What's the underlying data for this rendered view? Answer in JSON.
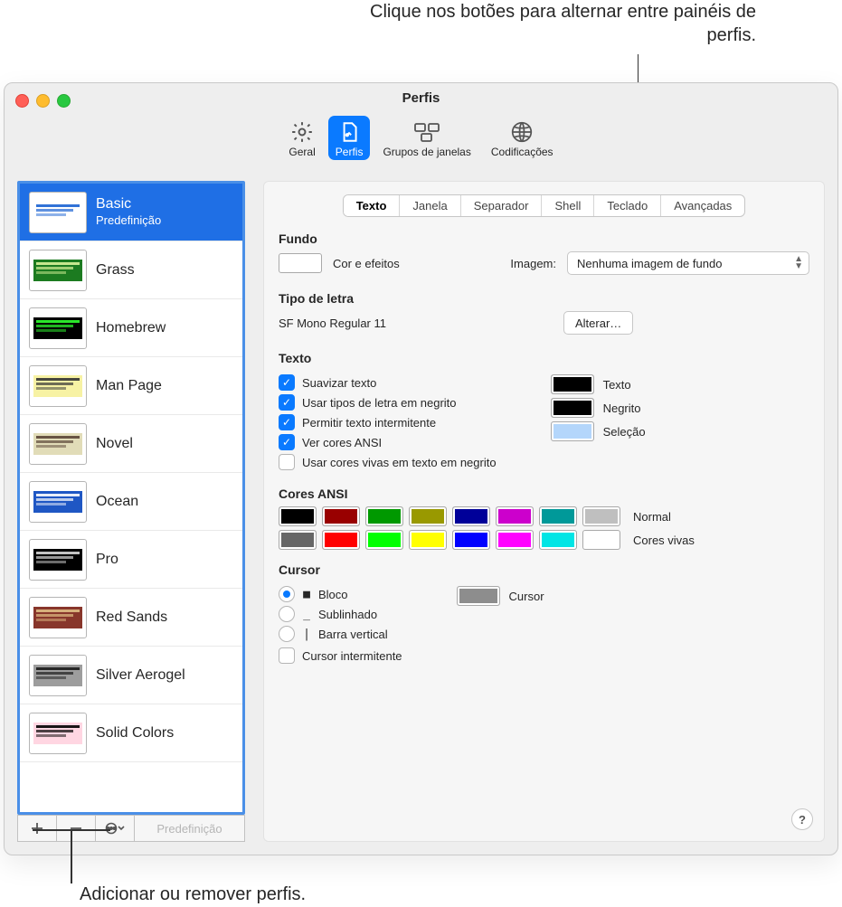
{
  "callouts": {
    "top": "Clique nos botões para alternar entre painéis de perfis.",
    "bottom": "Adicionar ou remover perfis."
  },
  "window": {
    "title": "Perfis"
  },
  "toolbar": {
    "items": [
      {
        "id": "general",
        "label": "Geral"
      },
      {
        "id": "profiles",
        "label": "Perfis"
      },
      {
        "id": "groups",
        "label": "Grupos de janelas"
      },
      {
        "id": "encodings",
        "label": "Codificações"
      }
    ]
  },
  "sidebar": {
    "selected": 0,
    "profiles": [
      {
        "name": "Basic",
        "sub": "Predefinição",
        "bg": "#ffffff",
        "fg": "#1b63d3"
      },
      {
        "name": "Grass",
        "bg": "#1c7b20",
        "fg": "#d9f39a"
      },
      {
        "name": "Homebrew",
        "bg": "#000000",
        "fg": "#2fff2f"
      },
      {
        "name": "Man Page",
        "bg": "#f7f2a4",
        "fg": "#333"
      },
      {
        "name": "Novel",
        "bg": "#e1dcb8",
        "fg": "#5a4436"
      },
      {
        "name": "Ocean",
        "bg": "#1f57c4",
        "fg": "#ffffff"
      },
      {
        "name": "Pro",
        "bg": "#000000",
        "fg": "#d7d7d7"
      },
      {
        "name": "Red Sands",
        "bg": "#88362b",
        "fg": "#dfbc84"
      },
      {
        "name": "Silver Aerogel",
        "bg": "#9d9d9d",
        "fg": "#1b1b1b"
      },
      {
        "name": "Solid Colors",
        "bg": "#ffd6e2",
        "fg": "#000"
      }
    ],
    "footer": {
      "default_label": "Predefinição"
    }
  },
  "tabs": {
    "items": [
      "Texto",
      "Janela",
      "Separador",
      "Shell",
      "Teclado",
      "Avançadas"
    ],
    "selected": 0
  },
  "sections": {
    "background": {
      "title": "Fundo",
      "color_label": "Cor e efeitos",
      "image_label": "Imagem:",
      "image_value": "Nenhuma imagem de fundo"
    },
    "font": {
      "title": "Tipo de letra",
      "value": "SF Mono Regular 11",
      "change_btn": "Alterar…"
    },
    "text": {
      "title": "Texto",
      "checks": [
        {
          "label": "Suavizar texto",
          "on": true
        },
        {
          "label": "Usar tipos de letra em negrito",
          "on": true
        },
        {
          "label": "Permitir texto intermitente",
          "on": true
        },
        {
          "label": "Ver cores ANSI",
          "on": true
        },
        {
          "label": "Usar cores vivas em texto em negrito",
          "on": false
        }
      ],
      "colors": [
        {
          "label": "Texto",
          "color": "#000000"
        },
        {
          "label": "Negrito",
          "color": "#000000"
        },
        {
          "label": "Seleção",
          "color": "#b4d6fb"
        }
      ]
    },
    "ansi": {
      "title": "Cores ANSI",
      "rows": [
        {
          "label": "Normal",
          "colors": [
            "#000000",
            "#990000",
            "#009900",
            "#999900",
            "#000099",
            "#cc00cc",
            "#009999",
            "#bfbfbf"
          ]
        },
        {
          "label": "Cores vivas",
          "colors": [
            "#666666",
            "#ff0000",
            "#00ff00",
            "#ffff00",
            "#0000ff",
            "#ff00ff",
            "#00e5e5",
            "#ffffff"
          ]
        }
      ]
    },
    "cursor": {
      "title": "Cursor",
      "opts": [
        {
          "label": "Bloco",
          "glyph": "■",
          "on": true
        },
        {
          "label": "Sublinhado",
          "glyph": "_",
          "on": false
        },
        {
          "label": "Barra vertical",
          "glyph": "|",
          "on": false
        }
      ],
      "blink": {
        "label": "Cursor intermitente",
        "on": false
      },
      "color": {
        "label": "Cursor",
        "color": "#8d8d8d"
      }
    }
  }
}
